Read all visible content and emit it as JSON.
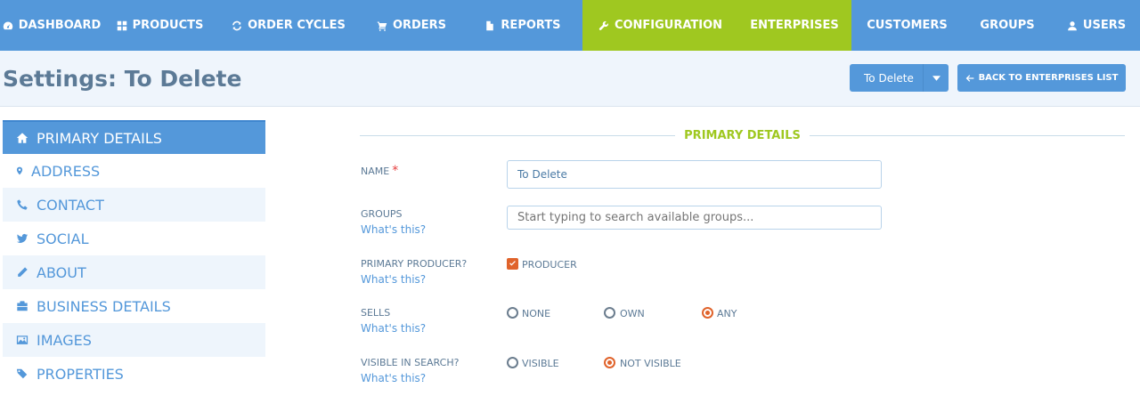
{
  "nav": {
    "items": [
      {
        "label": "Dashboard",
        "icon": "dashboard-icon"
      },
      {
        "label": "Products",
        "icon": "products-grid-icon"
      },
      {
        "label": "Order Cycles",
        "icon": "refresh-icon"
      },
      {
        "label": "Orders",
        "icon": "cart-icon"
      },
      {
        "label": "Reports",
        "icon": "file-icon"
      },
      {
        "label": "Configuration",
        "icon": "wrench-icon"
      },
      {
        "label": "Enterprises",
        "icon": ""
      },
      {
        "label": "Customers",
        "icon": ""
      },
      {
        "label": "Groups",
        "icon": ""
      },
      {
        "label": "Users",
        "icon": "user-icon"
      }
    ],
    "active_color": "#9fc820",
    "bg_color": "#5498da"
  },
  "header": {
    "title": "Settings: To Delete",
    "enterprise_select": {
      "value": "To Delete"
    },
    "back_button": "Back to Enterprises List"
  },
  "sidebar": {
    "items": [
      {
        "label": "Primary Details",
        "icon": "home-icon",
        "active": true
      },
      {
        "label": "Address",
        "icon": "map-marker-icon"
      },
      {
        "label": "Contact",
        "icon": "phone-icon"
      },
      {
        "label": "Social",
        "icon": "twitter-icon"
      },
      {
        "label": "About",
        "icon": "pencil-icon"
      },
      {
        "label": "Business Details",
        "icon": "briefcase-icon"
      },
      {
        "label": "Images",
        "icon": "picture-icon"
      },
      {
        "label": "Properties",
        "icon": "tags-icon"
      }
    ]
  },
  "form": {
    "section_title": "Primary Details",
    "whats_this": "What's this?",
    "name": {
      "label": "Name",
      "required_mark": "*",
      "value": "To Delete"
    },
    "groups": {
      "label": "Groups",
      "placeholder": "Start typing to search available groups..."
    },
    "primary_producer": {
      "label": "Primary Producer?",
      "option": "Producer",
      "checked": true
    },
    "sells": {
      "label": "Sells",
      "options": [
        "None",
        "Own",
        "Any"
      ],
      "selected": "Any"
    },
    "visible_in_search": {
      "label": "Visible in search?",
      "options": [
        "Visible",
        "Not visible"
      ],
      "selected": "Not visible"
    }
  },
  "colors": {
    "accent": "#e0632b",
    "link": "#5498da",
    "label": "#5c7a96"
  }
}
